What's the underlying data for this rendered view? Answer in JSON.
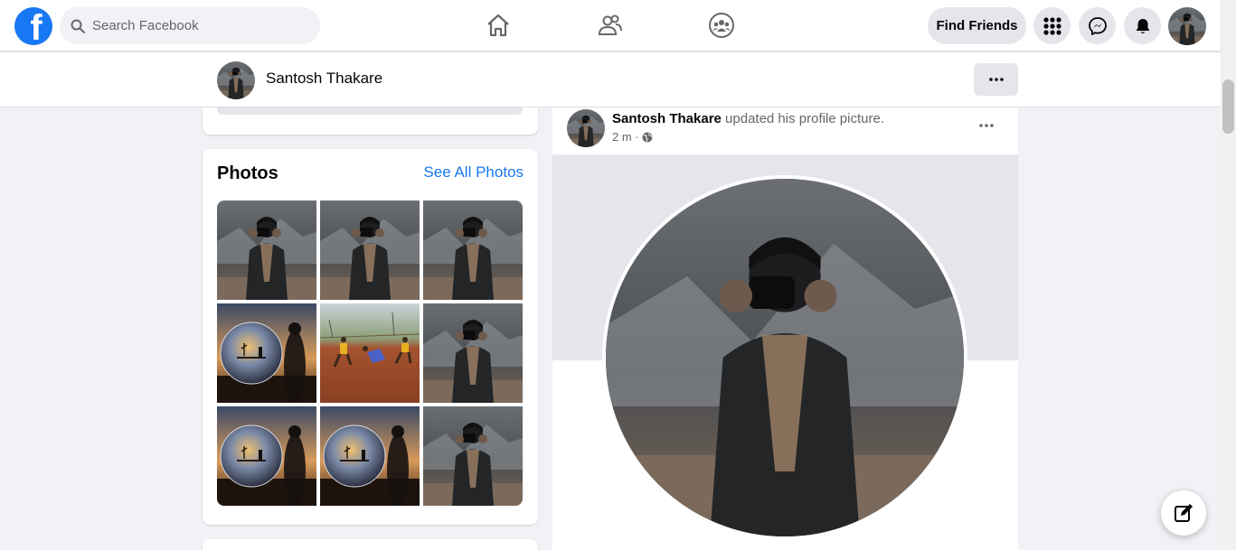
{
  "nav": {
    "search_placeholder": "Search Facebook",
    "find_friends_label": "Find Friends",
    "icons": [
      "home-icon",
      "friends-icon",
      "groups-icon",
      "menu-grid-icon",
      "messenger-icon",
      "notifications-icon"
    ]
  },
  "profile_bar": {
    "name": "Santosh Thakare"
  },
  "photos": {
    "title": "Photos",
    "see_all_label": "See All Photos",
    "items": [
      "photographer",
      "photographer",
      "photographer",
      "crystal-ball",
      "football",
      "photographer",
      "crystal-ball",
      "crystal-ball",
      "photographer"
    ]
  },
  "post": {
    "author": "Santosh Thakare",
    "action": "updated his profile picture.",
    "time": "2 m ·"
  },
  "colors": {
    "brand": "#1877f2",
    "background": "#f0f2f5",
    "button_gray": "#e4e6eb",
    "secondary_text": "#65676b"
  }
}
